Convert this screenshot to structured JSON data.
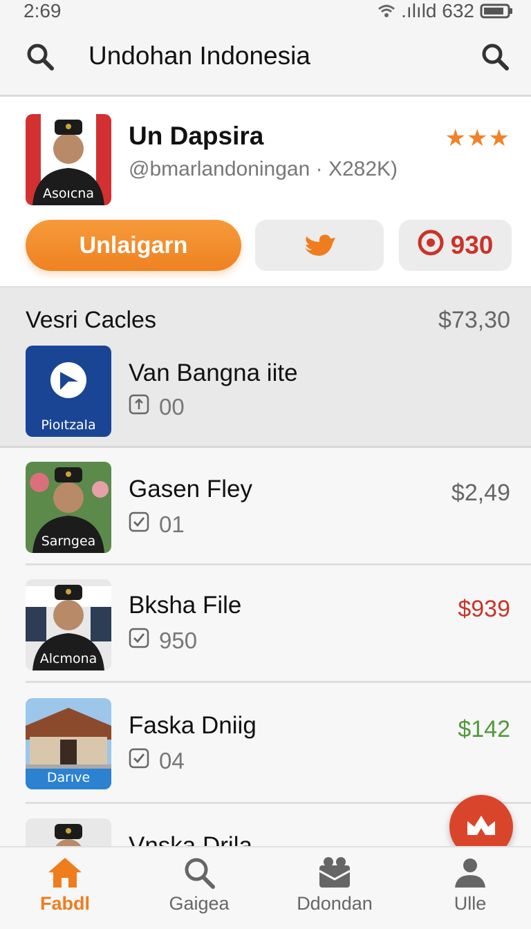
{
  "status_bar": {
    "time": "2:69",
    "signal_text": ".ılıld 632"
  },
  "app_bar": {
    "title": "Undohan Indonesia"
  },
  "profile": {
    "thumb_caption": "Asoıcna",
    "name": "Un Dapsira",
    "handle": "@bmarlandoningan · X282K)",
    "rating_stars": "★★★",
    "primary_button": "Unlaigarn",
    "target_count": "930"
  },
  "section": {
    "title": "Vesri Cacles",
    "total": "$73,30",
    "featured": {
      "thumb_caption": "Pioıtzala",
      "name": "Van Bangna iite",
      "meta": "00"
    }
  },
  "items": [
    {
      "name": "Gasen Fley",
      "meta": "01",
      "price": "$2,49",
      "price_color": "#666666",
      "thumb_caption": "Sarngea"
    },
    {
      "name": "Bksha File",
      "meta": "950",
      "price": "$939",
      "price_color": "#c9342a",
      "thumb_caption": "Alcmona"
    },
    {
      "name": "Faska Dniig",
      "meta": "04",
      "price": "$142",
      "price_color": "#4f9a3a",
      "thumb_caption": "Darıve"
    },
    {
      "name": "Vnska Drila"
    }
  ],
  "bottom_nav": [
    {
      "label": "Fabdl",
      "icon": "home-icon",
      "active": true
    },
    {
      "label": "Gaigea",
      "icon": "search-icon",
      "active": false
    },
    {
      "label": "Ddondan",
      "icon": "inbox-icon",
      "active": false
    },
    {
      "label": "Ulle",
      "icon": "user-icon",
      "active": false
    }
  ],
  "colors": {
    "accent": "#ef8222",
    "fab": "#d9452b"
  }
}
